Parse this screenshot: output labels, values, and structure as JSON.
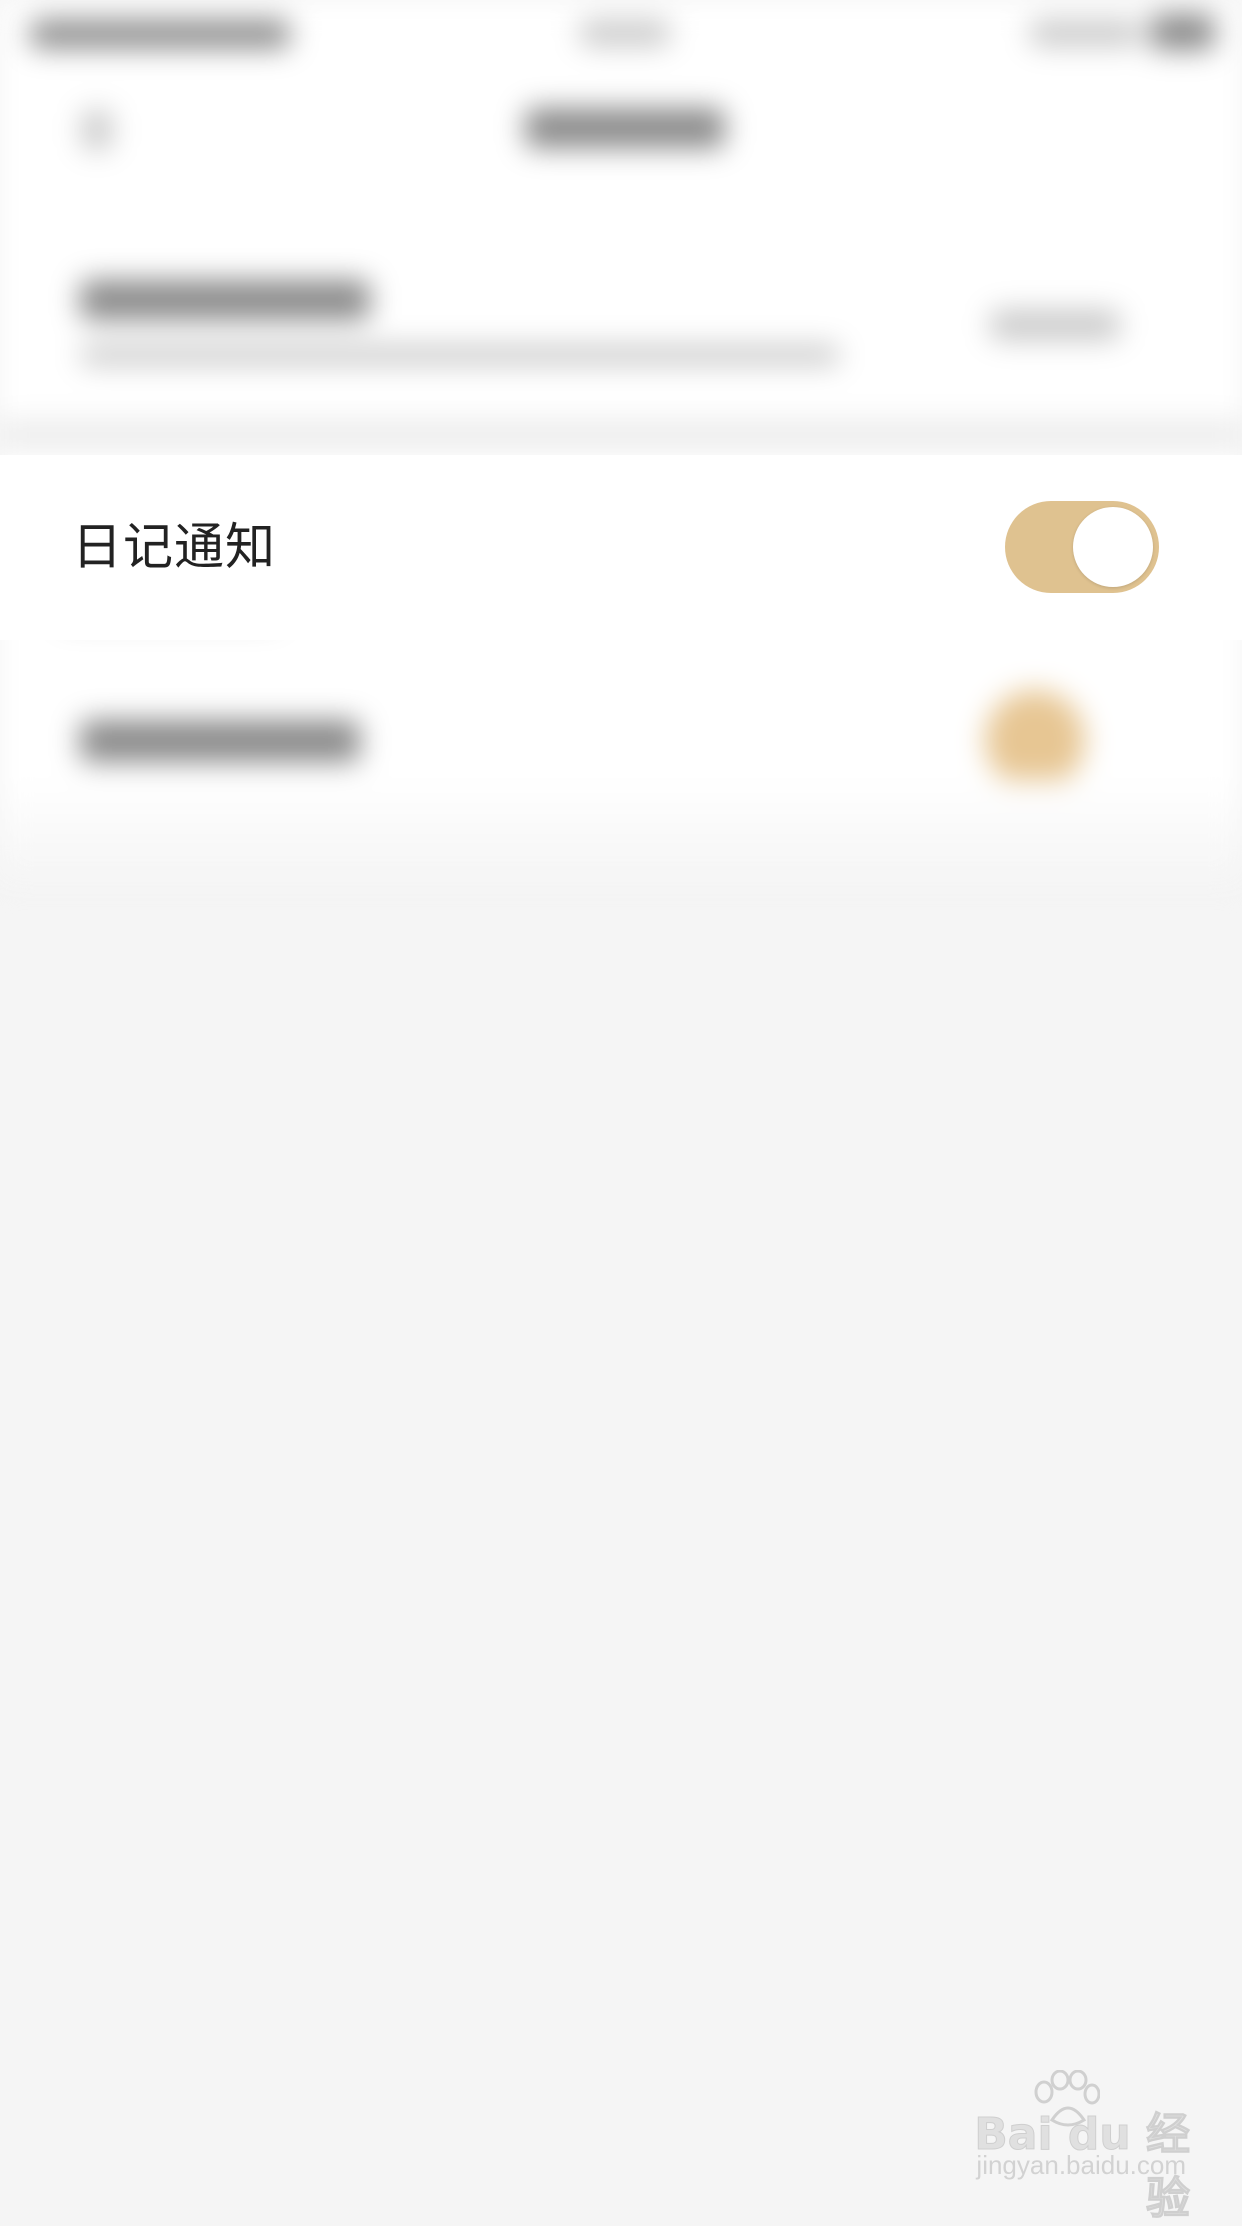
{
  "row": {
    "label": "日记通知",
    "toggle_on": true
  },
  "colors": {
    "accent": "#dfc290",
    "background": "#f5f5f5",
    "row_background": "#ffffff",
    "text": "#222222"
  },
  "watermark": {
    "brand": "Bai du 经验",
    "url": "jingyan.baidu.com"
  }
}
